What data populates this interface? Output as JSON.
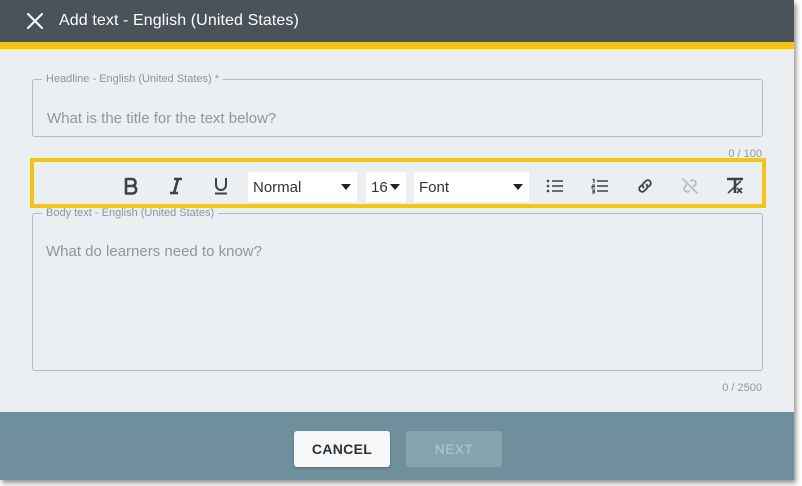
{
  "dialog": {
    "title": "Add text - English (United States)"
  },
  "headline": {
    "label": "Headline - English (United States) *",
    "placeholder": "What is the title for the text below?",
    "counter": "0 / 100"
  },
  "toolbar": {
    "bold_icon": "bold-icon",
    "italic_icon": "italic-icon",
    "underline_icon": "underline-icon",
    "style_select": "Normal",
    "size_select": "16",
    "font_select": "Font",
    "bullet_list_icon": "bullet-list-icon",
    "numbered_list_icon": "numbered-list-icon",
    "link_icon": "link-icon",
    "unlink_icon": "unlink-icon",
    "clear_format_icon": "clear-formatting-icon"
  },
  "body": {
    "label": "Body text - English (United States)",
    "placeholder": "What do learners need to know?",
    "counter": "0 / 2500"
  },
  "footer": {
    "cancel_label": "CANCEL",
    "next_label": "NEXT"
  },
  "colors": {
    "header": "#4a525a",
    "accent": "#f6c317",
    "footer": "#6f8f9c"
  }
}
